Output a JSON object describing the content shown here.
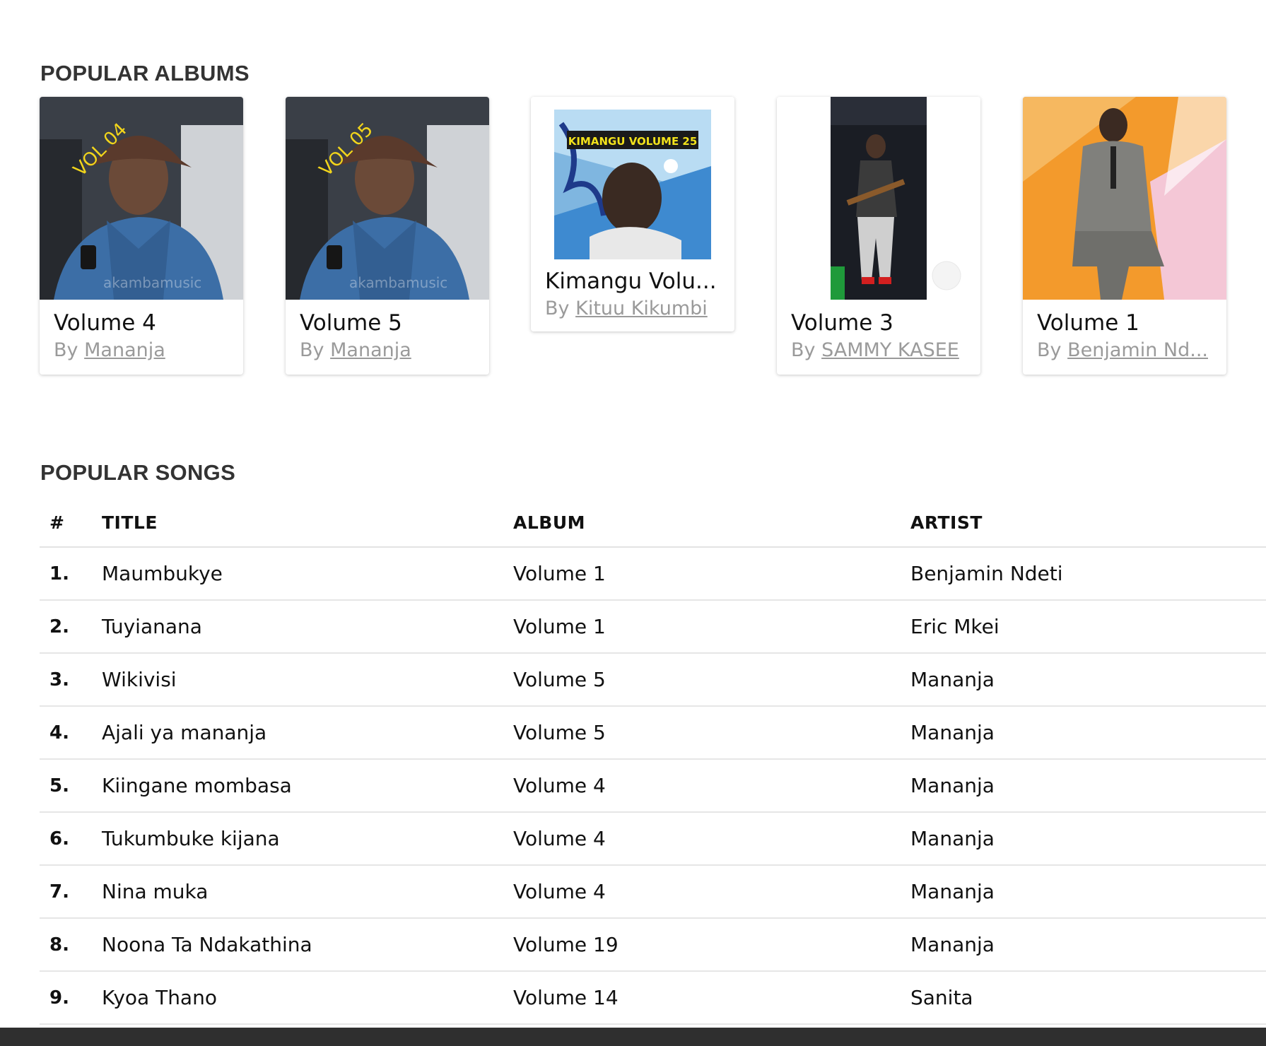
{
  "albums_section": {
    "title": "POPULAR ALBUMS"
  },
  "albums": [
    {
      "name": "Volume 4",
      "by": "By",
      "artist": "Mananja",
      "art_text": "VOL 04",
      "watermark": "akambamusic"
    },
    {
      "name": "Volume 5",
      "by": "By",
      "artist": "Mananja",
      "art_text": "VOL 05",
      "watermark": "akambamusic"
    },
    {
      "name": "Kimangu Volu...",
      "by": "By",
      "artist": "Kituu Kikumbi",
      "art_text": "KIMANGU VOLUME 25"
    },
    {
      "name": "Volume 3",
      "by": "By",
      "artist": "SAMMY KASEE"
    },
    {
      "name": "Volume 1",
      "by": "By",
      "artist": "Benjamin Nd..."
    }
  ],
  "songs_section": {
    "title": "POPULAR SONGS"
  },
  "songs_table": {
    "headers": {
      "num": "#",
      "title": "TITLE",
      "album": "ALBUM",
      "artist": "ARTIST"
    },
    "rows": [
      {
        "num": "1.",
        "title": "Maumbukye",
        "album": "Volume 1",
        "artist": "Benjamin Ndeti"
      },
      {
        "num": "2.",
        "title": "Tuyianana",
        "album": "Volume 1",
        "artist": "Eric Mkei"
      },
      {
        "num": "3.",
        "title": "Wikivisi",
        "album": "Volume 5",
        "artist": "Mananja"
      },
      {
        "num": "4.",
        "title": "Ajali ya mananja",
        "album": "Volume 5",
        "artist": "Mananja"
      },
      {
        "num": "5.",
        "title": "Kiingane mombasa",
        "album": "Volume 4",
        "artist": "Mananja"
      },
      {
        "num": "6.",
        "title": "Tukumbuke kijana",
        "album": "Volume 4",
        "artist": "Mananja"
      },
      {
        "num": "7.",
        "title": "Nina muka",
        "album": "Volume 4",
        "artist": "Mananja"
      },
      {
        "num": "8.",
        "title": "Noona Ta Ndakathina",
        "album": "Volume 19",
        "artist": "Mananja"
      },
      {
        "num": "9.",
        "title": "Kyoa Thano",
        "album": "Volume 14",
        "artist": "Sanita"
      }
    ]
  },
  "colors": {
    "section_title": "#333333",
    "muted": "#9a9a9a",
    "divider": "#e6e6e6",
    "footer": "#2f2f2f"
  }
}
